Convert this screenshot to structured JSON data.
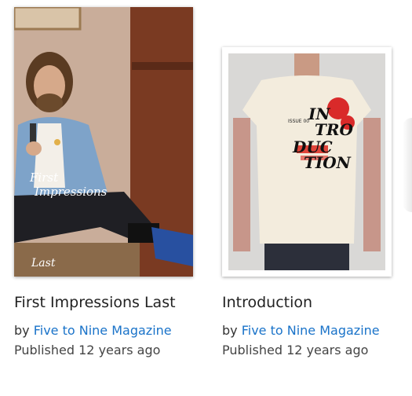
{
  "publications": [
    {
      "title": "First Impressions Last",
      "by_prefix": "by",
      "author": "Five to Nine Magazine",
      "published": "Published 12 years ago",
      "cover_text_line1": "First",
      "cover_text_line2": "Impressions",
      "cover_text_bottom": "Last"
    },
    {
      "title": "Introduction",
      "by_prefix": "by",
      "author": "Five to Nine Magazine",
      "published": "Published 12 years ago",
      "cover_text_issue": "ISSUE 00",
      "cover_text_l1": "IN",
      "cover_text_l2": "TRO",
      "cover_text_l3": "DUC",
      "cover_text_l4": "TION"
    }
  ]
}
